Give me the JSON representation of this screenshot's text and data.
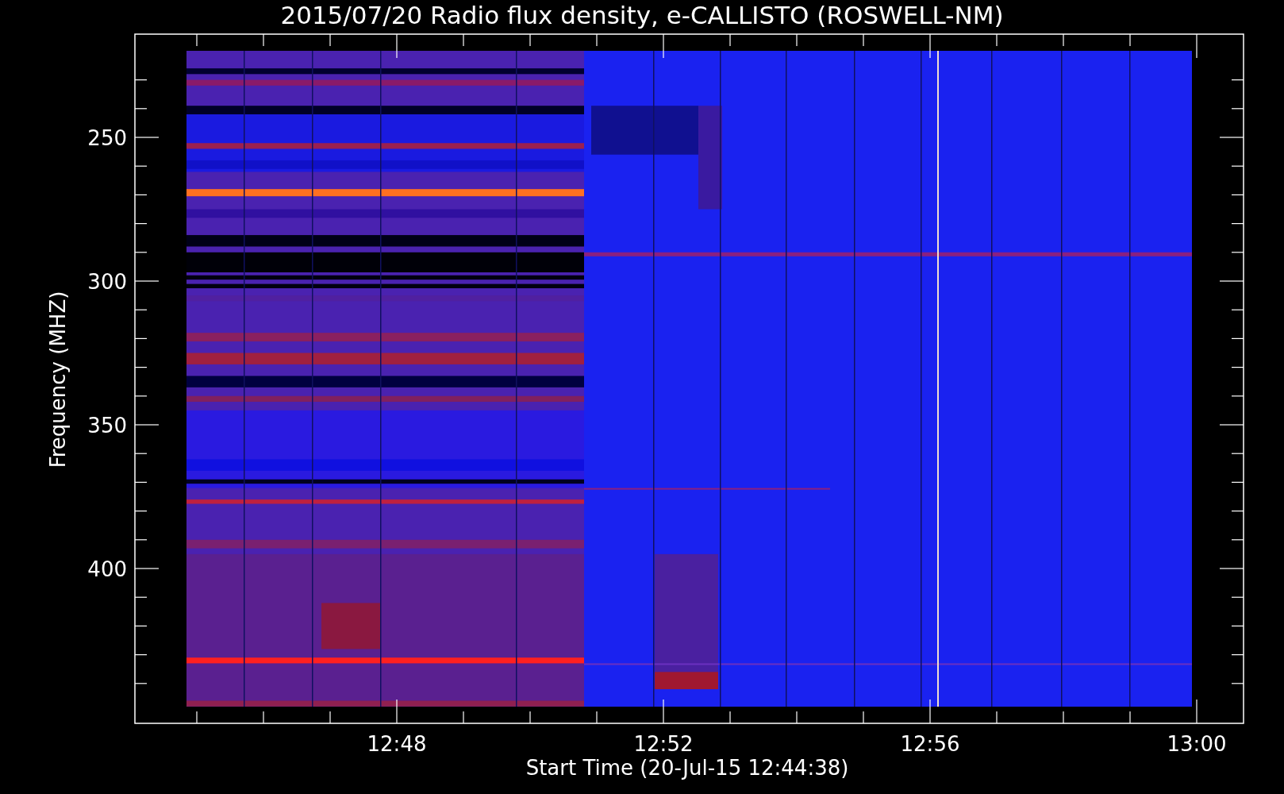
{
  "title": "2015/07/20  Radio flux density, e-CALLISTO (ROSWELL-NM)",
  "ylabel": "Frequency (MHZ)",
  "xlabel": "Start Time (20-Jul-15 12:44:38)",
  "yticks": [
    "250",
    "300",
    "350",
    "400"
  ],
  "xticks": [
    "12:48",
    "12:52",
    "12:56",
    "13:00"
  ]
}
